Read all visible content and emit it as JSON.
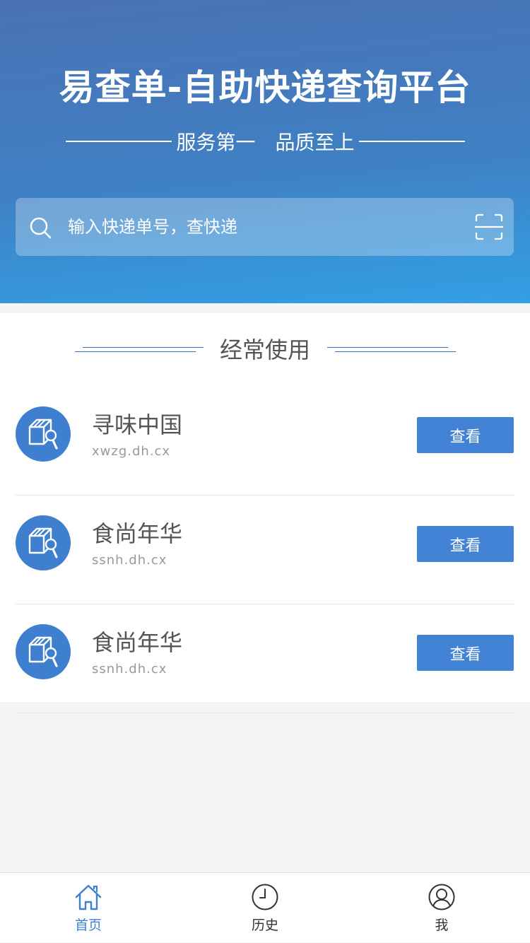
{
  "hero": {
    "title": "易查单-自助快递查询平台",
    "tagline_left": "服务第一",
    "tagline_right": "品质至上"
  },
  "search": {
    "placeholder": "输入快递单号，查快递",
    "icon": "search-icon",
    "scan_icon": "scan-icon"
  },
  "section": {
    "title": "经常使用"
  },
  "items": [
    {
      "name": "寻味中国",
      "domain": "xwzg.dh.cx",
      "button": "查看",
      "icon": "package-search-icon"
    },
    {
      "name": "食尚年华",
      "domain": "ssnh.dh.cx",
      "button": "查看",
      "icon": "package-search-icon"
    },
    {
      "name": "食尚年华",
      "domain": "ssnh.dh.cx",
      "button": "查看",
      "icon": "package-search-icon"
    }
  ],
  "tabbar": {
    "tabs": [
      {
        "label": "首页",
        "icon": "home-icon",
        "active": true
      },
      {
        "label": "历史",
        "icon": "clock-icon",
        "active": false
      },
      {
        "label": "我",
        "icon": "user-icon",
        "active": false
      }
    ]
  },
  "colors": {
    "primary": "#3f7fd0",
    "button": "#4283d5",
    "hero_top": "#4a72b4",
    "hero_bottom": "#32a0e4"
  }
}
